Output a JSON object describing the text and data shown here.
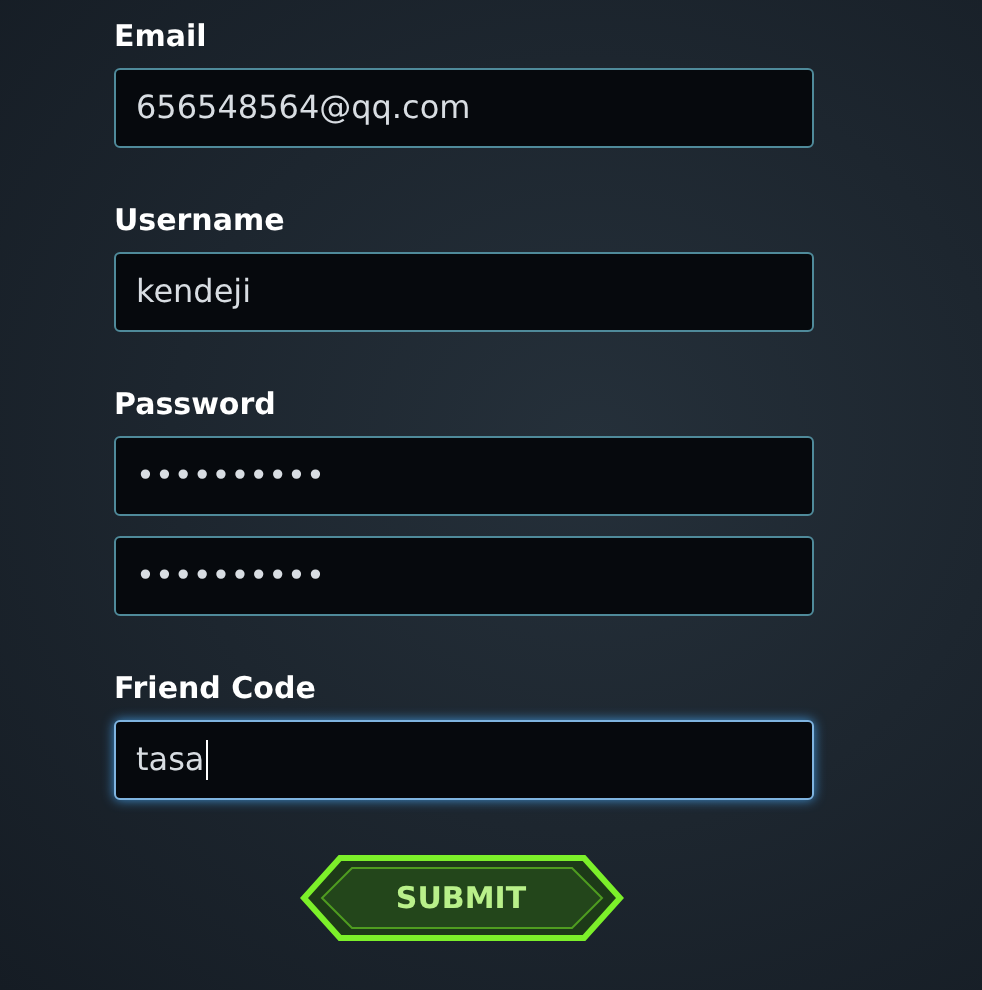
{
  "fields": [
    {
      "label": "Email",
      "inputs": [
        {
          "value": "656548564@qq.com",
          "focused": false
        }
      ]
    },
    {
      "label": "Username",
      "inputs": [
        {
          "value": "kendeji",
          "focused": false
        }
      ]
    },
    {
      "label": "Password",
      "inputs": [
        {
          "value": "••••••••••",
          "focused": false
        },
        {
          "value": "••••••••••",
          "focused": false
        }
      ]
    },
    {
      "label": "Friend Code",
      "inputs": [
        {
          "value": "tasa",
          "focused": true
        }
      ]
    }
  ],
  "submit": "SUBMIT"
}
